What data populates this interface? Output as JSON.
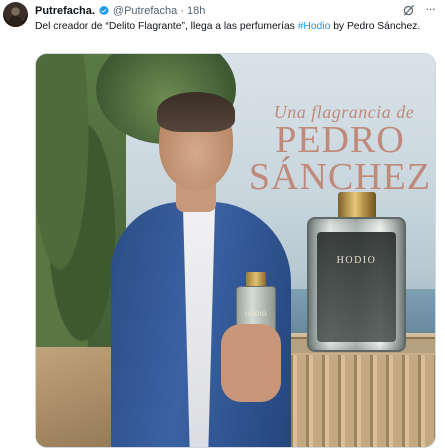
{
  "tweet": {
    "author_name": "Putrefacha.",
    "handle": "@Putrefacha",
    "separator": "·",
    "time": "18h",
    "text_before": "Del creador de “Delito Flagrante”, llega a las perfumerías ",
    "hashtag": "#Hodio",
    "text_after": " by Pedro Sánchez."
  },
  "media": {
    "headline_small": "Una flagrancia de",
    "headline_line1": "PEDRO",
    "headline_line2": "SÁNCHEZ",
    "bottle_label_big": "HODIO",
    "bottle_label_small": "HODIO"
  },
  "colors": {
    "hashtag": "#1d9bf0",
    "secondary_text": "#536471",
    "headline": "#c08a7b"
  }
}
